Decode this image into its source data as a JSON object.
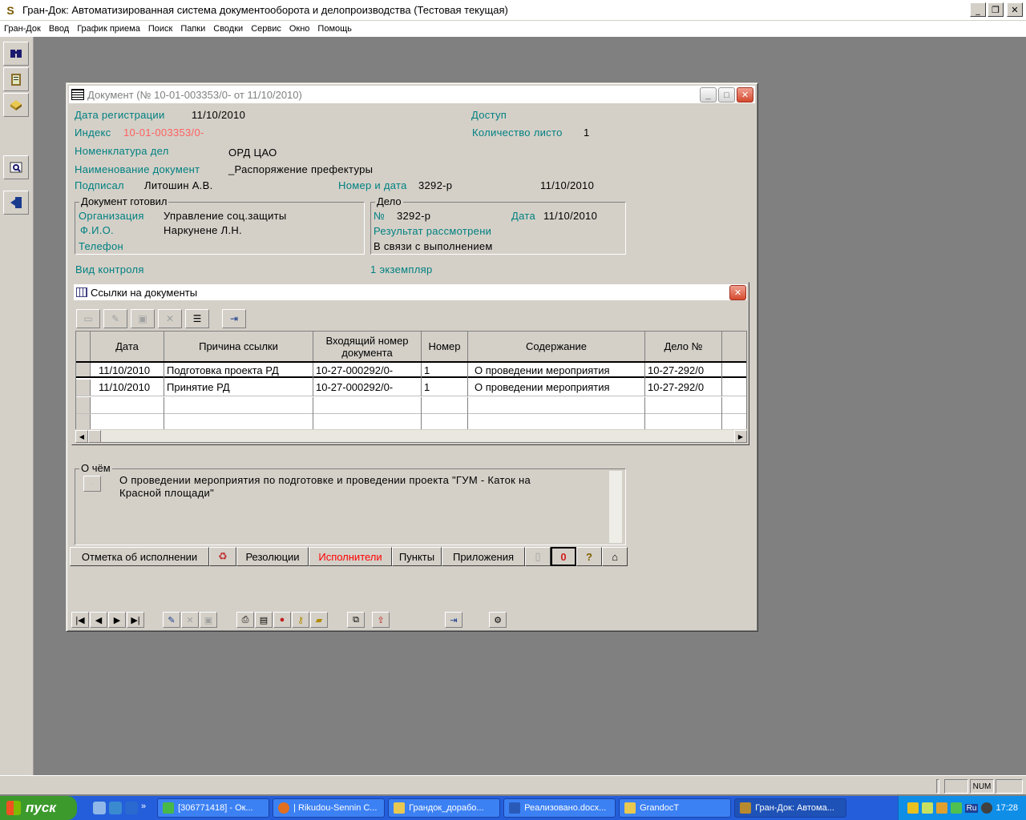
{
  "app": {
    "title": "Гран-Док: Автоматизированная система документооборота и делопроизводства  (Тестовая текущая)",
    "icon": "S"
  },
  "menu": [
    "Гран-Док",
    "Ввод",
    "График приема",
    "Поиск",
    "Папки",
    "Сводки",
    "Сервис",
    "Окно",
    "Помощь"
  ],
  "document": {
    "title": "Документ (№ 10-01-003353/0- от 11/10/2010)",
    "reg_date_label": "Дата регистрации",
    "reg_date": "11/10/2010",
    "access_label": "Доступ",
    "index_label": "Индекс",
    "index": "10-01-003353/0-",
    "pages_label": "Количество листо",
    "pages": "1",
    "nomenclature_label": "Номенклатура дел",
    "nomenclature": "ОРД ЦАО",
    "doc_name_label": "Наименование документ",
    "doc_name": "_Распоряжение префектуры",
    "signed_label": "Подписал",
    "signed": "Литошин А.В.",
    "num_date_label": "Номер и дата",
    "number": "3292-р",
    "date": "11/10/2010",
    "prepared_group": "Документ готовил",
    "org_label": "Организация",
    "org": "Управление соц.защиты",
    "fio_label": "Ф.И.О.",
    "fio": "Наркунене Л.Н.",
    "phone_label": "Телефон",
    "case_group": "Дело",
    "case_no_label": "№",
    "case_no": "3292-р",
    "case_date_label": "Дата",
    "case_date": "11/10/2010",
    "result_label": "Результат рассмотрени",
    "result": "В связи с выполнением",
    "control_label": "Вид контроля",
    "copies": "1 экземпляр"
  },
  "links": {
    "title": "Ссылки на документы",
    "columns": [
      "Дата",
      "Причина ссылки",
      "Входящий номер документа",
      "Номер",
      "Содержание",
      "Дело №"
    ],
    "rows": [
      [
        "11/10/2010",
        "Подготовка проекта РД",
        "10-27-000292/0-",
        "1",
        "О проведении мероприятия",
        "10-27-292/0"
      ],
      [
        "11/10/2010",
        "Принятие РД",
        "10-27-000292/0-",
        "1",
        "О проведении мероприятия",
        "10-27-292/0"
      ]
    ]
  },
  "about": {
    "label": "О чём",
    "text": "О проведении мероприятия по подготовке и проведении проекта \"ГУМ - Каток на Красной площади\""
  },
  "tabs": [
    "Отметка об исполнении",
    "Резолюции",
    "Исполнители",
    "Пункты",
    "Приложения"
  ],
  "statusbar": {
    "num": "NUM"
  },
  "taskbar": {
    "start": "пуск",
    "tasks": [
      "[306771418] - Ок...",
      "| Rikudou-Sennin C...",
      "Грандок_дорабо...",
      "Реализовано.docx...",
      "GrandocT",
      "Гран-Док: Автома..."
    ],
    "lang": "Ru",
    "time": "17:28"
  }
}
